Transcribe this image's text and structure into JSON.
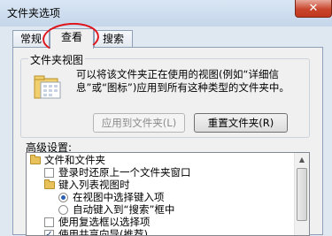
{
  "window": {
    "title": "文件夹选项",
    "close_glyph": "✕"
  },
  "tabs": [
    {
      "label": "常规"
    },
    {
      "label": "查看",
      "active": true
    },
    {
      "label": "搜索"
    }
  ],
  "folder_views": {
    "legend": "文件夹视图",
    "description": "可以将该文件夹正在使用的视图(例如“详细信息”或“图标”)应用到所有这种类型的文件夹中。",
    "apply_button": "应用到文件夹(L)",
    "reset_button": "重置文件夹(R)"
  },
  "advanced": {
    "label": "高级设置:",
    "items": [
      {
        "type": "folder",
        "label": "文件和文件夹"
      },
      {
        "type": "checkbox",
        "checked": false,
        "label": "登录时还原上一个文件夹窗口"
      },
      {
        "type": "folder",
        "label": "键入列表视图时"
      },
      {
        "type": "radio",
        "checked": true,
        "label": "在视图中选择键入项"
      },
      {
        "type": "radio",
        "checked": false,
        "label": "自动键入到“搜索”框中"
      },
      {
        "type": "checkbox",
        "checked": false,
        "label": "使用复选框以选择项"
      },
      {
        "type": "checkbox",
        "checked": true,
        "label": "使用共享向导(推荐)"
      }
    ]
  },
  "icons": {
    "close": "close-icon",
    "folder_large": "folder-view-icon",
    "folder_small": "folder-icon",
    "scroll_up": "scroll-up-arrow-icon"
  },
  "colors": {
    "annotation": "#e0151b",
    "close_button": "#c8462d"
  }
}
